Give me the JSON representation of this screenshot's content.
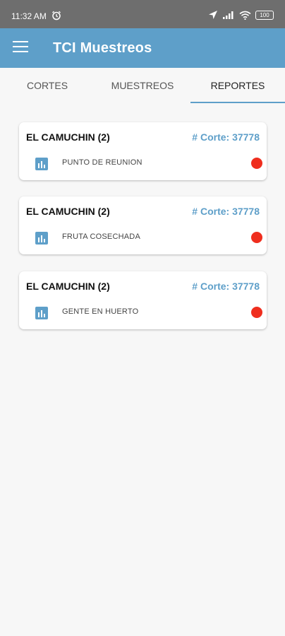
{
  "status_bar": {
    "time": "11:32 AM",
    "icons": [
      "alarm-icon",
      "location-icon",
      "signal-icon",
      "wifi-icon",
      "battery-icon"
    ],
    "battery_level": "100"
  },
  "app_bar": {
    "title": "TCI Muestreos",
    "color": "#5e9fc9"
  },
  "tabs": [
    {
      "label": "CORTES",
      "active": false
    },
    {
      "label": "MUESTREOS",
      "active": false
    },
    {
      "label": "REPORTES",
      "active": true
    }
  ],
  "reports": [
    {
      "title": "EL CAMUCHIN (2)",
      "corte": "# Corte: 37778",
      "label": "PUNTO DE REUNION",
      "status_color": "#ef2e1e"
    },
    {
      "title": "EL CAMUCHIN (2)",
      "corte": "# Corte: 37778",
      "label": "FRUTA COSECHADA",
      "status_color": "#ef2e1e"
    },
    {
      "title": "EL CAMUCHIN (2)",
      "corte": "# Corte: 37778",
      "label": "GENTE EN HUERTO",
      "status_color": "#ef2e1e"
    }
  ]
}
